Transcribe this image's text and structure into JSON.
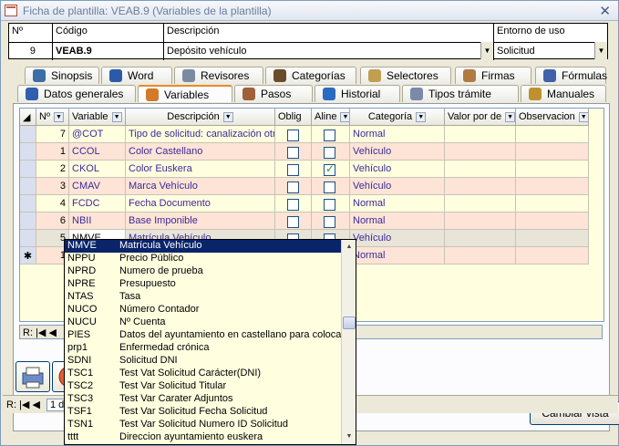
{
  "window": {
    "title": "Ficha de plantilla: VEAB.9 (Variables de la plantilla)",
    "close": "✕"
  },
  "header": {
    "n_label": "Nº",
    "n_value": "9",
    "codigo_label": "Código",
    "codigo_value": "VEAB.9",
    "descripcion_label": "Descripción",
    "descripcion_value": "Depósito vehículo",
    "entorno_label": "Entorno de uso",
    "entorno_value": "Solicitud"
  },
  "tabs_row1": [
    "Sinopsis",
    "Word",
    "Revisores",
    "Categorías",
    "Selectores",
    "Firmas",
    "Fórmulas"
  ],
  "tabs_row2": [
    "Datos generales",
    "Variables",
    "Pasos",
    "Historial",
    "Tipos trámite",
    "Manuales"
  ],
  "grid": {
    "columns": [
      "Nº",
      "Variable",
      "Descripción",
      "Oblig",
      "Aline",
      "Categoría",
      "Valor por de",
      "Observacion"
    ],
    "rows": [
      {
        "n": "7",
        "var": "@COT",
        "desc": "Tipo de solicitud: canalización otro",
        "oblig": false,
        "aline": false,
        "cat": "Normal"
      },
      {
        "n": "1",
        "var": "CCOL",
        "desc": "Color Castellano",
        "oblig": false,
        "aline": false,
        "cat": "Vehículo"
      },
      {
        "n": "2",
        "var": "CKOL",
        "desc": "Color Euskera",
        "oblig": false,
        "aline": true,
        "cat": "Vehículo"
      },
      {
        "n": "3",
        "var": "CMAV",
        "desc": "Marca Vehículo",
        "oblig": false,
        "aline": false,
        "cat": "Vehículo"
      },
      {
        "n": "4",
        "var": "FCDC",
        "desc": "Fecha Documento",
        "oblig": false,
        "aline": false,
        "cat": "Normal"
      },
      {
        "n": "6",
        "var": "NBII",
        "desc": "Base Imponible",
        "oblig": false,
        "aline": false,
        "cat": "Normal"
      },
      {
        "n": "5",
        "var": "NMVE",
        "desc": "Matrícula Vehículo",
        "oblig": false,
        "aline": false,
        "cat": "Vehículo"
      },
      {
        "n": "1",
        "var": "",
        "desc": "",
        "oblig": false,
        "aline": false,
        "cat": "Normal"
      }
    ],
    "new_row_marker": "✱"
  },
  "record_nav": {
    "label": "R:"
  },
  "cambiar_button": "Cambiar vista",
  "bottom_nav": {
    "label": "R:",
    "value": "1 de"
  },
  "dropdown": {
    "items": [
      {
        "code": "NMVE",
        "text": "Matrícula Vehículo"
      },
      {
        "code": "NPPU",
        "text": "Precio Público"
      },
      {
        "code": "NPRD",
        "text": "Numero de prueba"
      },
      {
        "code": "NPRE",
        "text": "Presupuesto"
      },
      {
        "code": "NTAS",
        "text": "Tasa"
      },
      {
        "code": "NUCO",
        "text": "Número Contador"
      },
      {
        "code": "NUCU",
        "text": "Nº Cuenta"
      },
      {
        "code": "PIES",
        "text": "Datos del ayuntamiento en castellano para colocar"
      },
      {
        "code": "prp1",
        "text": "Enfermedad crónica"
      },
      {
        "code": "SDNI",
        "text": "Solicitud DNI"
      },
      {
        "code": "TSC1",
        "text": "Test Vat Solicitud Carácter(DNI)"
      },
      {
        "code": "TSC2",
        "text": "Test Var Solicitud Titular"
      },
      {
        "code": "TSC3",
        "text": "Test Var Carater Adjuntos"
      },
      {
        "code": "TSF1",
        "text": "Test Var Solicitud Fecha Solicitud"
      },
      {
        "code": "TSN1",
        "text": "Test Var Solicitud Numero ID Solicitud"
      },
      {
        "code": "tttt",
        "text": "Direccion ayuntamiento euskera"
      }
    ]
  },
  "colors": {
    "row_yellow": "#ffffe0",
    "row_peach": "#fde4d6",
    "row_selected": "#e8e4d8",
    "selection": "#0a246a",
    "tab_accent": "#e68b2c"
  }
}
